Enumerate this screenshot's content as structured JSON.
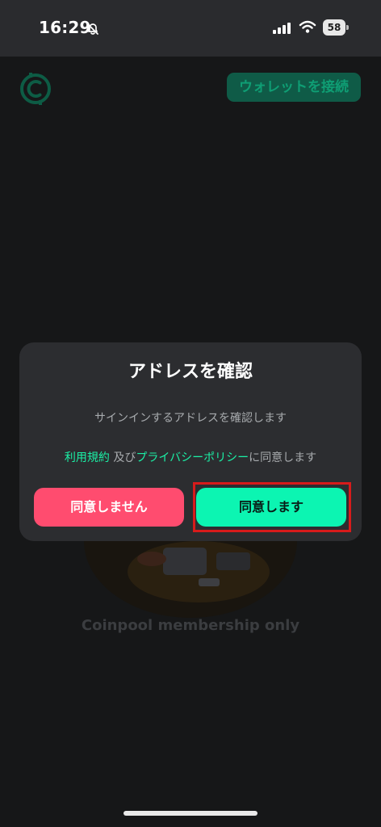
{
  "status_bar": {
    "time": "16:29",
    "battery": "58",
    "icons": [
      "bell-slash-icon",
      "signal-icon",
      "wifi-icon",
      "battery-icon"
    ]
  },
  "header": {
    "logo_icon": "coin-logo-icon",
    "connect_wallet_label": "ウォレットを接続"
  },
  "background": {
    "membership_text": "Coinpool membership only"
  },
  "modal": {
    "title": "アドレスを確認",
    "description": "サインインするアドレスを確認します",
    "terms": {
      "terms_link": "利用規約",
      "and": " 及び",
      "privacy_link": "プライバシーポリシー",
      "suffix": "に同意します"
    },
    "buttons": {
      "decline": "同意しません",
      "agree": "同意します"
    }
  },
  "colors": {
    "background": "#161718",
    "modal": "#2c2d30",
    "accent_green": "#0cf5b2",
    "link_green": "#1bf0a6",
    "decline_pink": "#ff4c6f",
    "highlight_red": "#d71b1b"
  }
}
